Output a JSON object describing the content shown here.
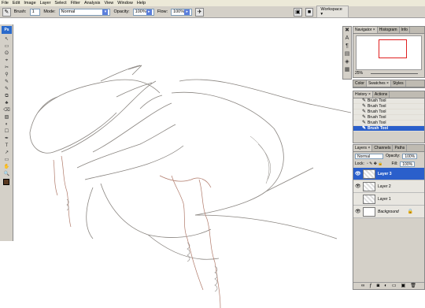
{
  "menubar": [
    "File",
    "Edit",
    "Image",
    "Layer",
    "Select",
    "Filter",
    "Analysis",
    "View",
    "Window",
    "Help"
  ],
  "options": {
    "brush_label": "Brush:",
    "brush_size": "1",
    "mode_label": "Mode:",
    "mode_value": "Normal",
    "opacity_label": "Opacity:",
    "opacity_value": "100%",
    "flow_label": "Flow:",
    "flow_value": "100%",
    "workspace_label": "Workspace ▾"
  },
  "toolbox": {
    "logo": "Ps",
    "tools": [
      "↖",
      "▭",
      "ʘ",
      "⌖",
      "✂",
      "⚲",
      "✎",
      "✎",
      "⧉",
      "♣",
      "⌫",
      "▨",
      "◐",
      "☐",
      "✒",
      "T",
      "↗",
      "▭",
      "✋",
      "🔍"
    ],
    "foreground_color": "#5a3a22"
  },
  "navigator": {
    "tabs": [
      "Navigator ×",
      "Histogram",
      "Info"
    ],
    "zoom": "25%"
  },
  "color_panel": {
    "tabs": [
      "Color",
      "Swatches ×",
      "Styles"
    ]
  },
  "history": {
    "tabs": [
      "History ×",
      "Actions"
    ],
    "items": [
      "Brush Tool",
      "Brush Tool",
      "Brush Tool",
      "Brush Tool",
      "Brush Tool",
      "Brush Tool"
    ]
  },
  "layers": {
    "tabs": [
      "Layers ×",
      "Channels",
      "Paths"
    ],
    "blend_mode": "Normal",
    "opacity_label": "Opacity:",
    "opacity_value": "100%",
    "lock_label": "Lock:",
    "fill_label": "Fill:",
    "fill_value": "100%",
    "items": [
      "Layer 3",
      "Layer 2",
      "Layer 1",
      "Background"
    ]
  },
  "colors": {
    "selection": "#2a5fcb",
    "chrome": "#d4d0c8",
    "sketch": "#8a8580",
    "sketch_red": "#b07a6a"
  }
}
